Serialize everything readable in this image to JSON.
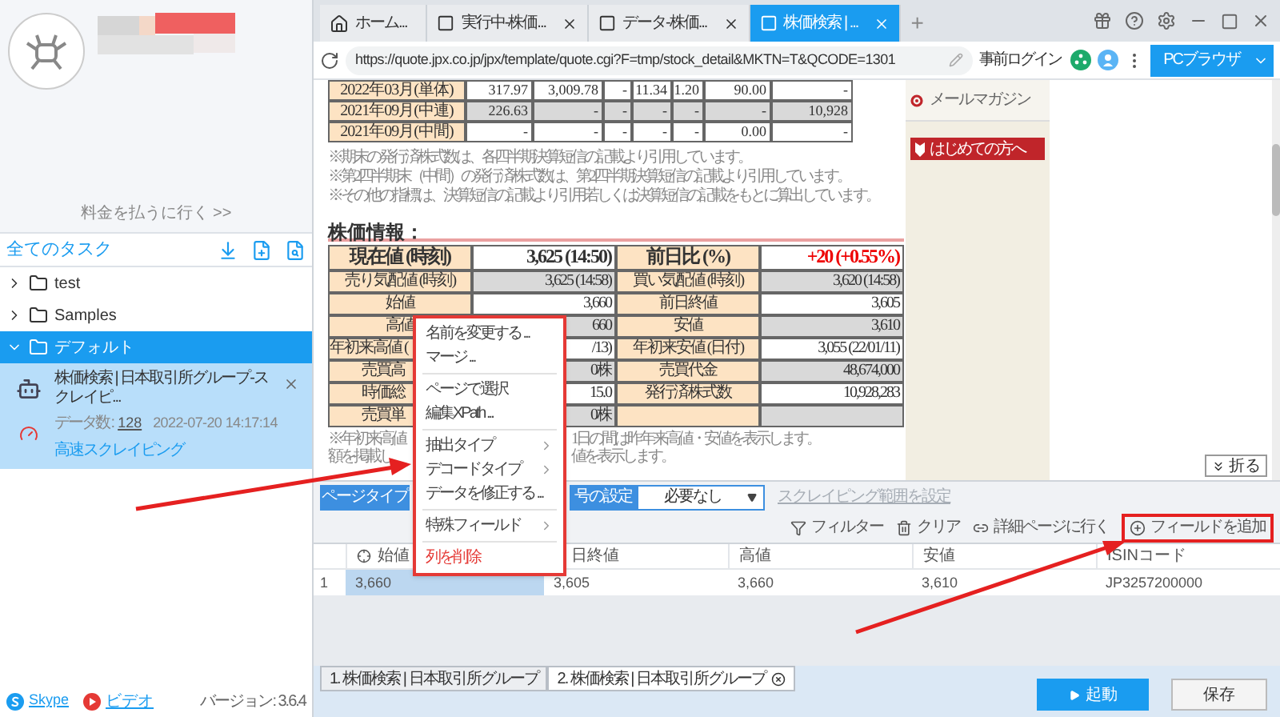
{
  "sidebar": {
    "account_link": "料金を払うに行く >>",
    "tasks_title": "全てのタスク",
    "folders": [
      {
        "label": "test",
        "expanded": false,
        "selected": false
      },
      {
        "label": "Samples",
        "expanded": false,
        "selected": false
      },
      {
        "label": "デフォルト",
        "expanded": true,
        "selected": true,
        "tasks": [
          {
            "name": "株価検索 | 日本取引所グループ-スクレイピ...",
            "count_label": "データ数 :",
            "count": "128",
            "time": "2022-07-20 14:17:14",
            "mode": "高速スクレイピング"
          }
        ]
      }
    ],
    "footer": {
      "skype": "Skype",
      "video": "ビデオ",
      "version": "バージョン: 3.6.4"
    }
  },
  "browser_tabs": [
    {
      "kind": "home",
      "label": "ホーム...",
      "selected": false
    },
    {
      "kind": "page",
      "label": "実行中-株価...",
      "selected": false
    },
    {
      "kind": "page",
      "label": "データ-株価...",
      "selected": false
    },
    {
      "kind": "page",
      "label": "株価検索 | ...",
      "selected": true
    }
  ],
  "new_tab": "+",
  "address_bar": {
    "url": "https://quote.jpx.co.jp/jpx/template/quote.cgi?F=tmp/stock_detail&MKTN=T&QCODE=1301",
    "login": "事前ログイン",
    "browser_mode": "PCブラウザ"
  },
  "web_page": {
    "history_rows": [
      {
        "label": "2022年03月(単体)",
        "values": [
          "317.97",
          "3,009.78",
          "-",
          "11.34",
          "1.20",
          "90.00",
          "-"
        ]
      },
      {
        "label": "2021年09月(中連)",
        "values": [
          "226.63",
          "-",
          "-",
          "-",
          "-",
          "-",
          "10,928"
        ]
      },
      {
        "label": "2021年09月(中間)",
        "values": [
          "-",
          "-",
          "-",
          "-",
          "-",
          "0.00",
          "-"
        ]
      }
    ],
    "notes": [
      "※期末の発行済株式数は、各四半期決算短信の記載より引用しています。",
      "※第2四半期末（中間）の発行済株式数は、第2四半期決算短信の記載より引用しています。",
      "※その他の指標は、決算短信の記載より引用若しくは決算短信の記載をもとに算出しています。"
    ],
    "stock_heading": "株価情報：",
    "change_up": true,
    "stock_rows": [
      {
        "label1": "現在値 (時刻)",
        "value1": "3,625 (14:50)",
        "label2": "前日比 (%)",
        "value2": "+20 (+0.55%)"
      },
      {
        "label1": "売り気配値 (時刻)",
        "value1": "3,625 (14:58)",
        "label2": "買い気配値 (時刻)",
        "value2": "3,620 (14:58)"
      },
      {
        "label1": "始値",
        "value1": "3,660",
        "label2": "前日終値",
        "value2": "3,605"
      },
      {
        "label1": "高値",
        "value1": "660",
        "label2": "安値",
        "value2": "3,610"
      },
      {
        "label1": "年初来高値 (",
        "value1": "/13)",
        "label2": "年初来安値 (日付)",
        "value2": "3,055 (22/01/11)"
      },
      {
        "label1": "売買高",
        "value1": "0株",
        "label2": "売買代金",
        "value2": "48,674,000"
      },
      {
        "label1": "時価総",
        "value1": "15.0",
        "label2": "発行済株式数",
        "value2": "10,928,283"
      },
      {
        "label1": "売買単",
        "value1": "0株"
      }
    ],
    "after_notes": [
      {
        "left": "※年初来高値",
        "right": "1日の間は昨年来高値・安値を表示します。"
      },
      {
        "left": "額を掲載し",
        "right": "値を表示します。"
      }
    ],
    "mail_link": "メールマガジン",
    "beginner_button": "はじめての方へ",
    "fold_button": "折る"
  },
  "context_menu": [
    {
      "kind": "item",
      "label": "名前を変更する ..."
    },
    {
      "kind": "item",
      "label": "マージ ..."
    },
    {
      "kind": "divider"
    },
    {
      "kind": "item",
      "label": "ページで選択"
    },
    {
      "kind": "item",
      "label": "編集XPath ..."
    },
    {
      "kind": "divider"
    },
    {
      "kind": "submenu",
      "label": "抽出タイプ"
    },
    {
      "kind": "submenu",
      "label": "デコードタイプ"
    },
    {
      "kind": "item",
      "label": "データを修正する ..."
    },
    {
      "kind": "divider"
    },
    {
      "kind": "submenu",
      "label": "特殊フィールド"
    },
    {
      "kind": "divider"
    },
    {
      "kind": "danger",
      "label": "列を削除"
    }
  ],
  "toolbar": {
    "page_type": "ページタイプ",
    "numbering_label": "号の設定",
    "numbering_value": "必要なし",
    "scrape_range": {
      "label": "スクレイピング範囲を設定",
      "disabled": true
    },
    "filter": "フィルター",
    "clear": "クリア",
    "detail_page": "詳細ページに行く",
    "add_field": "フィールドを追加"
  },
  "data_table": {
    "columns": [
      "始値",
      "日終値",
      "高値",
      "安値",
      "ISINコード"
    ],
    "rows": [
      {
        "index": "1",
        "cells": [
          {
            "text": "3,660",
            "selected": true
          },
          {
            "text": "3,605",
            "selected": false
          },
          {
            "text": "3,660",
            "selected": false
          },
          {
            "text": "3,610",
            "selected": false
          },
          {
            "text": "JP3257200000",
            "selected": false
          }
        ]
      }
    ]
  },
  "bottom_tabs": [
    {
      "label": "1. 株価検索 | 日本取引所グループ",
      "selected": false
    },
    {
      "label": "2. 株価検索 | 日本取引所グループ",
      "selected": true
    }
  ],
  "actions": {
    "start": "起動",
    "save": "保存"
  }
}
